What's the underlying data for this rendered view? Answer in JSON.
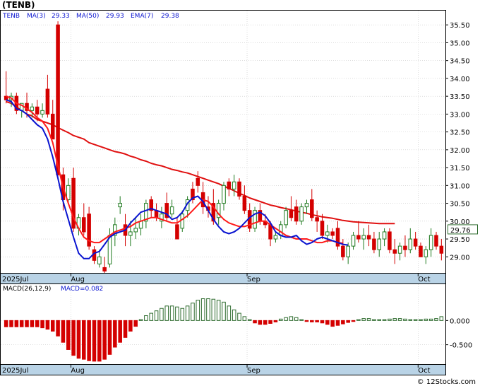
{
  "title": "(TENB)",
  "credit": "© 12Stocks.com",
  "main_legend": {
    "ticker": "TENB",
    "ma3_label": "MA(3)",
    "ma3_value": "29.33",
    "ma50_label": "MA(50)",
    "ma50_value": "29.93",
    "ema7_label": "EMA(7)",
    "ema7_value": "29.38"
  },
  "macd_legend": {
    "label": "MACD(26,12,9)",
    "value_label": "MACD=0.082"
  },
  "last_price_label": "29.76",
  "x_labels": [
    {
      "text": "2025Jul",
      "bar": 0
    },
    {
      "text": "Aug",
      "bar": 13
    },
    {
      "text": "Sep",
      "bar": 47
    },
    {
      "text": "Oct",
      "bar": 80
    }
  ],
  "colors": {
    "up": "#1f7a1f",
    "down": "#d40000",
    "ma50": "#e01010",
    "ma3": "#0a14d0",
    "ema7": "#ff1a1a",
    "macd_up": "#2e6b2e",
    "macd_down": "#d40000",
    "axis_band": "#b9d3e6",
    "grid": "#c8c8c8"
  },
  "chart_data": {
    "type": "candlestick",
    "y_ticks": [
      29.0,
      29.5,
      30.0,
      30.5,
      31.0,
      31.5,
      32.0,
      32.5,
      33.0,
      33.5,
      34.0,
      34.5,
      35.0,
      35.5
    ],
    "ylim": [
      28.55,
      35.9
    ],
    "last_price": 29.76,
    "candles": [
      [
        33.5,
        34.2,
        33.3,
        33.4
      ],
      [
        33.4,
        33.6,
        33.2,
        33.5
      ],
      [
        33.5,
        33.6,
        33.0,
        33.1
      ],
      [
        33.1,
        33.3,
        32.9,
        33.3
      ],
      [
        33.3,
        33.6,
        32.9,
        33.1
      ],
      [
        33.1,
        33.3,
        32.9,
        33.2
      ],
      [
        33.2,
        33.4,
        32.8,
        33.0
      ],
      [
        33.0,
        33.3,
        32.9,
        33.1
      ],
      [
        33.7,
        34.1,
        32.9,
        33.0
      ],
      [
        33.0,
        33.4,
        32.3,
        32.3
      ],
      [
        35.5,
        35.6,
        31.2,
        31.3
      ],
      [
        31.3,
        31.5,
        30.3,
        30.6
      ],
      [
        30.6,
        31.2,
        30.5,
        31.0
      ],
      [
        31.2,
        31.5,
        29.7,
        29.8
      ],
      [
        29.8,
        30.2,
        29.6,
        30.1
      ],
      [
        30.1,
        30.5,
        29.6,
        29.7
      ],
      [
        30.2,
        30.4,
        29.2,
        29.3
      ],
      [
        29.2,
        29.3,
        28.8,
        28.9
      ],
      [
        28.8,
        29.2,
        28.7,
        29.0
      ],
      [
        28.7,
        29.0,
        28.4,
        28.6
      ],
      [
        28.8,
        29.8,
        28.7,
        29.6
      ],
      [
        29.6,
        30.1,
        29.3,
        29.9
      ],
      [
        30.4,
        30.7,
        30.2,
        30.5
      ],
      [
        29.9,
        30.2,
        29.3,
        29.6
      ],
      [
        29.6,
        30.0,
        29.3,
        29.7
      ],
      [
        29.7,
        30.1,
        29.5,
        29.8
      ],
      [
        29.8,
        30.2,
        29.6,
        30.0
      ],
      [
        30.0,
        30.6,
        29.8,
        30.5
      ],
      [
        30.6,
        30.7,
        30.1,
        30.3
      ],
      [
        30.3,
        30.5,
        30.0,
        30.1
      ],
      [
        30.0,
        30.4,
        29.8,
        30.2
      ],
      [
        30.5,
        30.8,
        30.0,
        30.1
      ],
      [
        30.2,
        30.6,
        30.1,
        30.4
      ],
      [
        29.9,
        30.1,
        29.5,
        29.5
      ],
      [
        29.8,
        30.3,
        29.7,
        30.2
      ],
      [
        30.3,
        30.7,
        30.1,
        30.6
      ],
      [
        30.9,
        31.1,
        30.5,
        30.6
      ],
      [
        31.2,
        31.4,
        30.8,
        31.0
      ],
      [
        30.8,
        31.1,
        30.2,
        30.4
      ],
      [
        30.4,
        30.7,
        30.1,
        30.3
      ],
      [
        30.5,
        30.9,
        29.9,
        30.0
      ],
      [
        30.1,
        30.6,
        29.9,
        30.5
      ],
      [
        30.5,
        31.1,
        30.3,
        31.0
      ],
      [
        31.1,
        31.2,
        30.7,
        30.9
      ],
      [
        30.9,
        31.3,
        30.7,
        31.1
      ],
      [
        31.1,
        31.2,
        30.6,
        30.7
      ],
      [
        30.7,
        31.0,
        30.2,
        30.3
      ],
      [
        30.3,
        30.5,
        29.7,
        29.8
      ],
      [
        29.8,
        30.4,
        29.7,
        30.3
      ],
      [
        30.3,
        30.5,
        29.9,
        30.0
      ],
      [
        30.0,
        30.2,
        29.8,
        29.9
      ],
      [
        29.9,
        30.0,
        29.3,
        29.5
      ],
      [
        29.5,
        29.7,
        29.4,
        29.6
      ],
      [
        29.6,
        30.0,
        29.5,
        29.9
      ],
      [
        29.9,
        30.4,
        29.8,
        30.3
      ],
      [
        30.3,
        30.7,
        30.0,
        30.1
      ],
      [
        30.4,
        30.6,
        29.9,
        30.0
      ],
      [
        30.0,
        30.5,
        29.9,
        30.4
      ],
      [
        30.4,
        30.6,
        30.2,
        30.5
      ],
      [
        30.6,
        30.9,
        30.0,
        30.1
      ],
      [
        30.1,
        30.3,
        29.7,
        30.0
      ],
      [
        30.0,
        30.2,
        29.5,
        29.6
      ],
      [
        29.6,
        29.9,
        29.4,
        29.7
      ],
      [
        29.7,
        29.8,
        29.5,
        29.6
      ],
      [
        29.8,
        30.0,
        29.2,
        29.3
      ],
      [
        29.3,
        29.5,
        28.9,
        29.0
      ],
      [
        29.0,
        29.4,
        28.8,
        29.3
      ],
      [
        29.3,
        29.7,
        29.2,
        29.6
      ],
      [
        29.6,
        30.0,
        29.4,
        29.5
      ],
      [
        29.5,
        29.8,
        29.2,
        29.6
      ],
      [
        29.6,
        29.9,
        29.3,
        29.5
      ],
      [
        29.5,
        29.7,
        29.1,
        29.2
      ],
      [
        29.2,
        29.7,
        29.0,
        29.5
      ],
      [
        29.5,
        29.8,
        29.3,
        29.7
      ],
      [
        29.7,
        29.8,
        29.1,
        29.2
      ],
      [
        29.2,
        29.5,
        28.8,
        29.1
      ],
      [
        29.1,
        29.4,
        28.9,
        29.3
      ],
      [
        29.3,
        29.6,
        29.0,
        29.2
      ],
      [
        29.2,
        29.8,
        29.1,
        29.5
      ],
      [
        29.5,
        29.7,
        29.2,
        29.3
      ],
      [
        29.3,
        29.4,
        29.0,
        29.0
      ],
      [
        29.0,
        29.3,
        28.8,
        29.2
      ],
      [
        29.2,
        29.8,
        29.0,
        29.6
      ],
      [
        29.6,
        29.7,
        29.2,
        29.3
      ],
      [
        29.3,
        29.5,
        28.9,
        29.1
      ]
    ],
    "ma50": [
      33.35,
      33.3,
      33.2,
      33.1,
      33.0,
      32.95,
      32.85,
      32.8,
      32.75,
      32.7,
      32.62,
      32.55,
      32.48,
      32.4,
      32.35,
      32.3,
      32.2,
      32.15,
      32.1,
      32.05,
      32.0,
      31.95,
      31.92,
      31.88,
      31.82,
      31.78,
      31.72,
      31.68,
      31.62,
      31.58,
      31.55,
      31.5,
      31.45,
      31.42,
      31.38,
      31.35,
      31.3,
      31.25,
      31.2,
      31.15,
      31.1,
      31.05,
      30.98,
      30.92,
      30.85,
      30.78,
      30.72,
      30.65,
      30.6,
      30.55,
      30.5,
      30.45,
      30.42,
      30.38,
      30.35,
      30.32,
      30.28,
      30.25,
      30.22,
      30.18,
      30.15,
      30.12,
      30.1,
      30.08,
      30.05,
      30.02,
      30.0,
      29.98,
      29.97,
      29.96,
      29.95,
      29.94,
      29.93,
      29.93,
      29.93,
      29.93
    ],
    "ma3": [
      33.4,
      33.35,
      33.15,
      33.1,
      33.0,
      32.85,
      32.7,
      32.6,
      32.3,
      31.8,
      31.2,
      30.55,
      30.05,
      29.55,
      29.1,
      28.95,
      28.95,
      29.1,
      29.15,
      29.35,
      29.55,
      29.65,
      29.7,
      29.75,
      29.95,
      30.1,
      30.25,
      30.3,
      30.35,
      30.3,
      30.25,
      30.2,
      30.05,
      30.1,
      30.25,
      30.5,
      30.65,
      30.7,
      30.55,
      30.3,
      30.05,
      29.85,
      29.7,
      29.65,
      29.7,
      29.8,
      29.95,
      30.1,
      30.2,
      30.25,
      30.15,
      29.95,
      29.7,
      29.6,
      29.55,
      29.55,
      29.6,
      29.45,
      29.35,
      29.4,
      29.5,
      29.55,
      29.5,
      29.45,
      29.4,
      29.35,
      29.33
    ],
    "ema7": [
      33.5,
      33.45,
      33.3,
      33.25,
      33.15,
      33.05,
      32.9,
      32.8,
      32.6,
      32.2,
      31.55,
      30.95,
      30.5,
      30.1,
      29.8,
      29.55,
      29.45,
      29.4,
      29.4,
      29.5,
      29.6,
      29.7,
      29.75,
      29.8,
      29.85,
      29.95,
      30.0,
      30.05,
      30.1,
      30.1,
      30.05,
      30.0,
      29.95,
      29.95,
      30.05,
      30.15,
      30.3,
      30.45,
      30.6,
      30.55,
      30.4,
      30.2,
      30.05,
      29.95,
      29.9,
      29.85,
      29.85,
      29.9,
      29.95,
      30.0,
      30.0,
      29.9,
      29.8,
      29.7,
      29.6,
      29.55,
      29.5,
      29.5,
      29.5,
      29.45,
      29.4,
      29.4,
      29.45,
      29.45,
      29.4,
      29.38
    ],
    "macd_ylim": [
      -0.9,
      0.75
    ],
    "macd_ticks": [
      0.0,
      -0.5
    ],
    "macd_tick_labels": [
      "0.000",
      "-0.500"
    ],
    "macd_hist": [
      -0.13,
      -0.13,
      -0.13,
      -0.13,
      -0.13,
      -0.13,
      -0.13,
      -0.15,
      -0.18,
      -0.22,
      -0.32,
      -0.45,
      -0.6,
      -0.72,
      -0.78,
      -0.8,
      -0.83,
      -0.84,
      -0.84,
      -0.8,
      -0.7,
      -0.55,
      -0.45,
      -0.35,
      -0.22,
      -0.12,
      0.02,
      0.1,
      0.15,
      0.2,
      0.25,
      0.3,
      0.3,
      0.28,
      0.25,
      0.3,
      0.36,
      0.42,
      0.45,
      0.45,
      0.44,
      0.42,
      0.38,
      0.3,
      0.22,
      0.15,
      0.08,
      0.02,
      -0.05,
      -0.08,
      -0.08,
      -0.06,
      -0.03,
      0.03,
      0.06,
      0.08,
      0.06,
      0.02,
      -0.02,
      -0.03,
      -0.03,
      -0.05,
      -0.08,
      -0.12,
      -0.1,
      -0.07,
      -0.04,
      -0.02,
      0.02,
      0.04,
      0.04,
      0.02,
      0.02,
      0.02,
      0.03,
      0.04,
      0.04,
      0.03,
      0.02,
      0.02,
      0.02,
      0.03,
      0.03,
      0.04,
      0.08
    ]
  }
}
